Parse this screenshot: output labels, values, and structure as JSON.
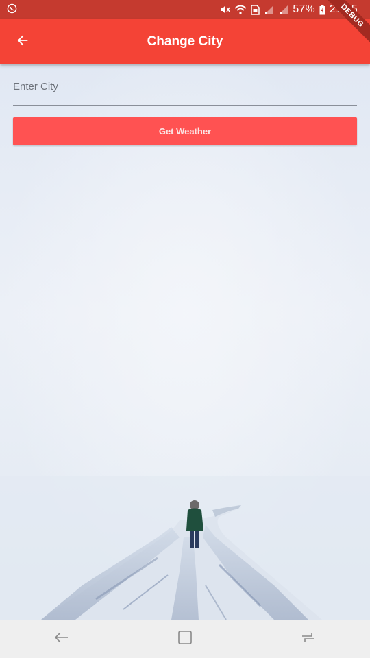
{
  "status_bar": {
    "battery": "57%",
    "time": "21:45",
    "icons": [
      "whatsapp-icon",
      "mute-icon",
      "wifi-icon",
      "sim-icon",
      "signal-icon",
      "signal-icon",
      "battery-charging-icon"
    ]
  },
  "app_bar": {
    "title": "Change City",
    "back_icon": "arrow-back-icon",
    "color": "#f44336"
  },
  "debug_banner": {
    "label": "DEBUG"
  },
  "form": {
    "city_input": {
      "placeholder": "Enter City",
      "value": ""
    },
    "submit_label": "Get Weather",
    "button_color": "#ff5252"
  },
  "nav_bar": {
    "icons": [
      "back-icon",
      "home-icon",
      "recents-icon"
    ]
  }
}
